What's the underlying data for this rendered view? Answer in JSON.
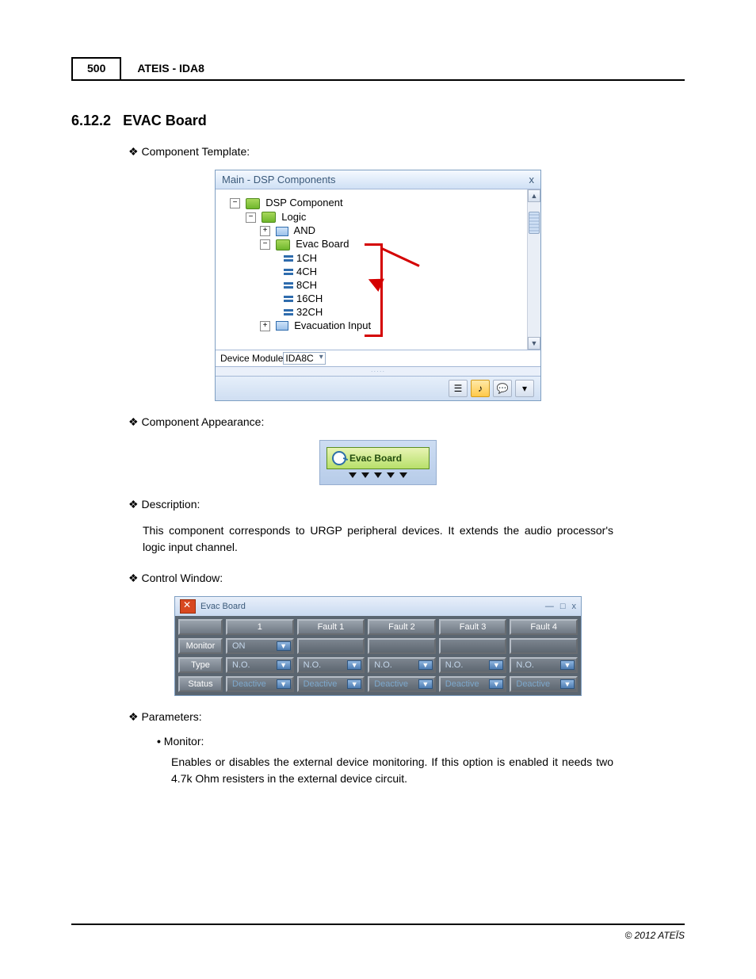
{
  "header": {
    "page_number": "500",
    "doc_title": "ATEIS - IDA8"
  },
  "section": {
    "number": "6.12.2",
    "title": "EVAC Board"
  },
  "labels": {
    "component_template": "Component Template:",
    "component_appearance": "Component Appearance:",
    "description": "Description:",
    "control_window": "Control Window:",
    "parameters": "Parameters:"
  },
  "dsp": {
    "title": "Main - DSP Components",
    "close": "x",
    "tree": {
      "root": "DSP Component",
      "logic": "Logic",
      "and": "AND",
      "evac": "Evac Board",
      "ch": [
        "1CH",
        "4CH",
        "8CH",
        "16CH",
        "32CH"
      ],
      "evac_input": "Evacuation Input"
    },
    "device_label": "Device Module",
    "device_value": "IDA8C",
    "scroll_up": "▲",
    "scroll_down": "▼"
  },
  "badge": {
    "text": "Evac Board"
  },
  "description_text": "This component corresponds to URGP peripheral devices. It extends the audio processor's logic input channel.",
  "ctrl": {
    "title": "Evac Board",
    "minimize": "—",
    "maximize": "□",
    "close": "x",
    "cols": [
      "",
      "1",
      "Fault 1",
      "Fault 2",
      "Fault 3",
      "Fault 4"
    ],
    "rows": {
      "monitor": {
        "label": "Monitor",
        "v1": "ON"
      },
      "type": {
        "label": "Type",
        "vals": [
          "N.O.",
          "N.O.",
          "N.O.",
          "N.O.",
          "N.O."
        ]
      },
      "status": {
        "label": "Status",
        "vals": [
          "Deactive",
          "Deactive",
          "Deactive",
          "Deactive",
          "Deactive"
        ]
      }
    }
  },
  "params": {
    "monitor_label": "Monitor:",
    "monitor_text": "Enables or disables the external device monitoring. If this option is enabled it needs two 4.7k Ohm resisters in the external device circuit."
  },
  "footer": {
    "copyright": "© 2012 ATEÏS"
  }
}
